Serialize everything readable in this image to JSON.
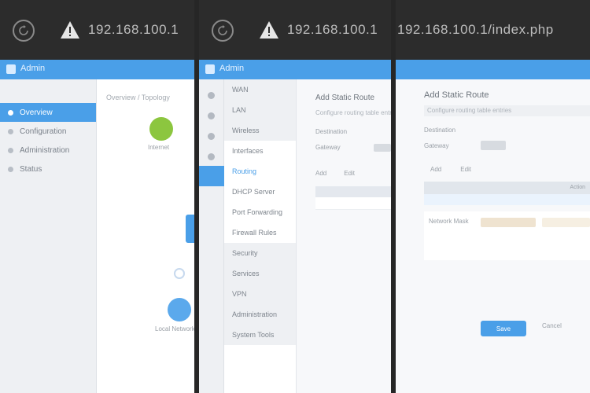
{
  "browser": {
    "url": "192.168.100.1",
    "url_tail": "/index.php",
    "refresh_icon": "refresh-icon",
    "warning_icon": "warning-triangle-icon"
  },
  "app": {
    "brand": "Admin",
    "accent_color": "#4a9fe8",
    "success_color": "#8cc63f"
  },
  "panel1": {
    "sidebar": [
      {
        "label": "Overview",
        "active": true
      },
      {
        "label": "Configuration",
        "active": false
      },
      {
        "label": "Administration",
        "active": false
      },
      {
        "label": "Status",
        "active": false
      }
    ],
    "breadcrumb": "Overview / Topology",
    "nodes": {
      "top_label": "Internet",
      "bottom_label": "Local Network"
    }
  },
  "panel2": {
    "menu": [
      {
        "label": "WAN",
        "shade": true,
        "selected": false
      },
      {
        "label": "LAN",
        "shade": true,
        "selected": false
      },
      {
        "label": "Wireless",
        "shade": true,
        "selected": false
      },
      {
        "label": "Interfaces",
        "shade": false,
        "selected": false
      },
      {
        "label": "Routing",
        "shade": false,
        "selected": true
      },
      {
        "label": "DHCP Server",
        "shade": false,
        "selected": false
      },
      {
        "label": "Port Forwarding",
        "shade": false,
        "selected": false
      },
      {
        "label": "Firewall Rules",
        "shade": false,
        "selected": false
      },
      {
        "label": "Security",
        "shade": true,
        "selected": false
      },
      {
        "label": "Services",
        "shade": true,
        "selected": false
      },
      {
        "label": "VPN",
        "shade": true,
        "selected": false
      },
      {
        "label": "Administration",
        "shade": true,
        "selected": false
      },
      {
        "label": "System Tools",
        "shade": true,
        "selected": false
      }
    ],
    "title": "Add Static Route",
    "subtitle": "Configure routing table entries",
    "row1_label": "Destination",
    "row2_label": "Gateway",
    "tabs": [
      "Add",
      "Edit"
    ]
  },
  "panel3": {
    "title": "Add Static Route",
    "subtitle": "Configure routing table entries",
    "row1_label": "Destination",
    "row2_label": "Gateway",
    "tabs": [
      "Add",
      "Edit"
    ],
    "table_header": "Action",
    "form_label": "Network Mask",
    "save_label": "Save",
    "cancel_label": "Cancel"
  }
}
